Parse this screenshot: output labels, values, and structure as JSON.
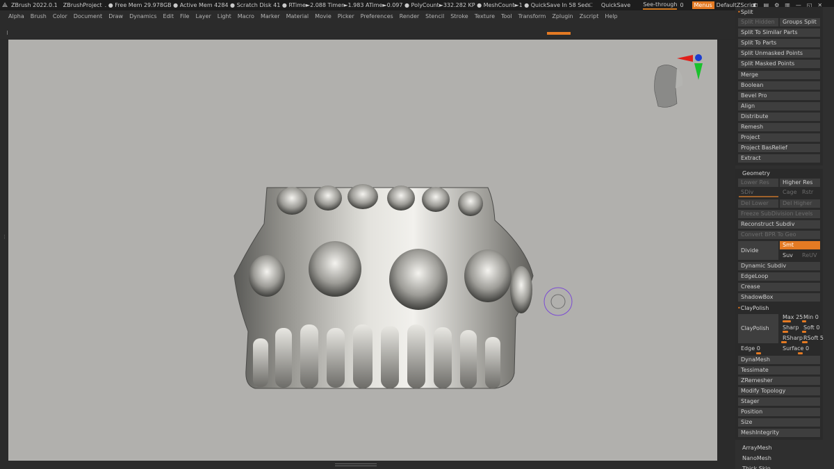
{
  "titlebar": {
    "app": "ZBrush 2022.0.1",
    "project": "ZBrushProject",
    "stats": ". ● Free Mem 29.978GB ● Active Mem 4284 ● Scratch Disk 41 ● RTime►2.088 Timer►1.983 ATime►0.097 ● PolyCount►332.282 KP ● MeshCount►1 ● QuickSave In 58 Secs",
    "ac": "AC",
    "quicksave": "QuickSave",
    "see_through": "See-through",
    "see_through_value": "0",
    "menus": "Menus",
    "default_zscript": "DefaultZScript"
  },
  "menubar": {
    "items": [
      "Alpha",
      "Brush",
      "Color",
      "Document",
      "Draw",
      "Dynamics",
      "Edit",
      "File",
      "Layer",
      "Light",
      "Macro",
      "Marker",
      "Material",
      "Movie",
      "Picker",
      "Preferences",
      "Render",
      "Stencil",
      "Stroke",
      "Texture",
      "Tool",
      "Transform",
      "Zplugin",
      "Zscript",
      "Help"
    ]
  },
  "panel": {
    "split_section": {
      "title": "Split",
      "split_hidden": "Split Hidden",
      "groups_split": "Groups Split",
      "split_similar": "Split To Similar Parts",
      "split_parts": "Split To Parts",
      "split_unmasked": "Split Unmasked Points",
      "split_masked": "Split Masked Points"
    },
    "subtool_items": [
      "Merge",
      "Boolean",
      "Bevel Pro",
      "Align",
      "Distribute",
      "Remesh",
      "Project",
      "Project BasRelief",
      "Extract"
    ],
    "geometry": {
      "title": "Geometry",
      "lower_res": "Lower Res",
      "higher_res": "Higher Res",
      "sdiv": "SDiv",
      "cage": "Cage",
      "rstr": "Rstr",
      "del_lower": "Del Lower",
      "del_higher": "Del Higher",
      "freeze": "Freeze SubDivision Levels",
      "reconstruct": "Reconstruct Subdiv",
      "convert_bpr": "Convert BPR To Geo",
      "divide": "Divide",
      "smt": "Smt",
      "suv": "Suv",
      "reuv": "ReUV",
      "dynamic_subdiv": "Dynamic Subdiv",
      "edgeloop": "EdgeLoop",
      "crease": "Crease",
      "shadowbox": "ShadowBox",
      "claypolish_title": "ClayPolish",
      "claypolish_btn": "ClayPolish",
      "max_label": "Max",
      "max_value": "25",
      "min_label": "Min",
      "min_value": "0",
      "sharp_label": "Sharp",
      "soft_label": "Soft",
      "soft_value": "0",
      "rsharp_label": "RSharp",
      "rsoft_label": "RSoft",
      "rsoft_value": "5",
      "edge_label": "Edge",
      "edge_value": "0",
      "surface_label": "Surface",
      "surface_value": "0",
      "after_items": [
        "DynaMesh",
        "Tessimate",
        "ZRemesher",
        "Modify Topology",
        "Stager",
        "Position",
        "Size",
        "MeshIntegrity"
      ]
    },
    "bottom_items": [
      "ArrayMesh",
      "NanoMesh",
      "Thick Skin"
    ]
  },
  "colors": {
    "accent": "#e47a23",
    "viewport_bg": "#b1b0ad",
    "panel_bg": "#2f2f2f"
  }
}
